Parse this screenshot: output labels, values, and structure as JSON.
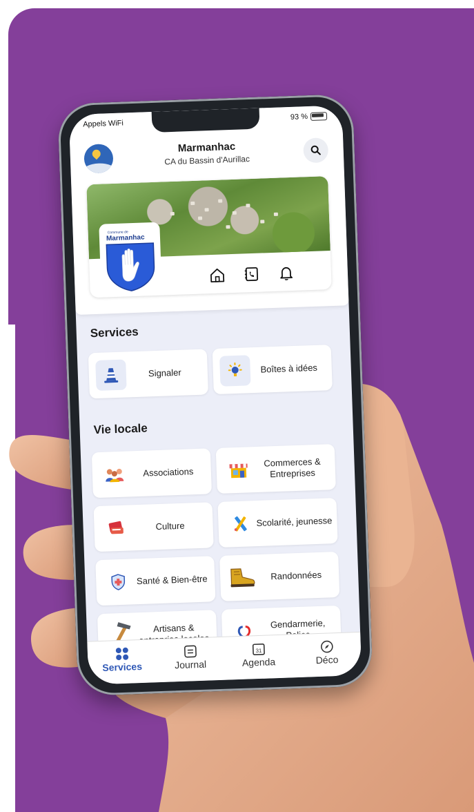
{
  "status_bar": {
    "carrier": "Appels WiFi",
    "battery": "93 %"
  },
  "header": {
    "title": "Marmanhac",
    "subtitle": "CA du Bassin d'Aurillac"
  },
  "banner": {
    "crest_caption": "Commune de",
    "crest_name": "Marmanhac"
  },
  "sections": {
    "services": {
      "title": "Services",
      "items": [
        {
          "label": "Signaler",
          "icon": "traffic-cone-icon"
        },
        {
          "label": "Boîtes à idées",
          "icon": "lightbulb-icon"
        }
      ]
    },
    "vie_locale": {
      "title": "Vie locale",
      "items": [
        {
          "label": "Associations",
          "icon": "people-icon"
        },
        {
          "label": "Commerces & Entreprises",
          "icon": "shop-icon"
        },
        {
          "label": "Culture",
          "icon": "books-icon"
        },
        {
          "label": "Scolarité, jeunesse",
          "icon": "school-supplies-icon"
        },
        {
          "label": "Santé & Bien-être",
          "icon": "health-shield-icon"
        },
        {
          "label": "Randonnées",
          "icon": "hiking-boot-icon"
        },
        {
          "label": "Artisans & entreprise locales",
          "icon": "hammer-icon"
        },
        {
          "label": "Gendarmerie, Police",
          "icon": "gendarmerie-icon"
        }
      ]
    }
  },
  "tabbar": [
    {
      "label": "Services",
      "icon": "grid-icon",
      "active": true
    },
    {
      "label": "Journal",
      "icon": "journal-icon"
    },
    {
      "label": "Agenda",
      "icon": "calendar-icon",
      "calendar_day": "31"
    },
    {
      "label": "Déco",
      "icon": "compass-icon"
    }
  ],
  "colors": {
    "background": "#843f9a",
    "accent": "#2f58b6",
    "screen": "#eceef8"
  }
}
